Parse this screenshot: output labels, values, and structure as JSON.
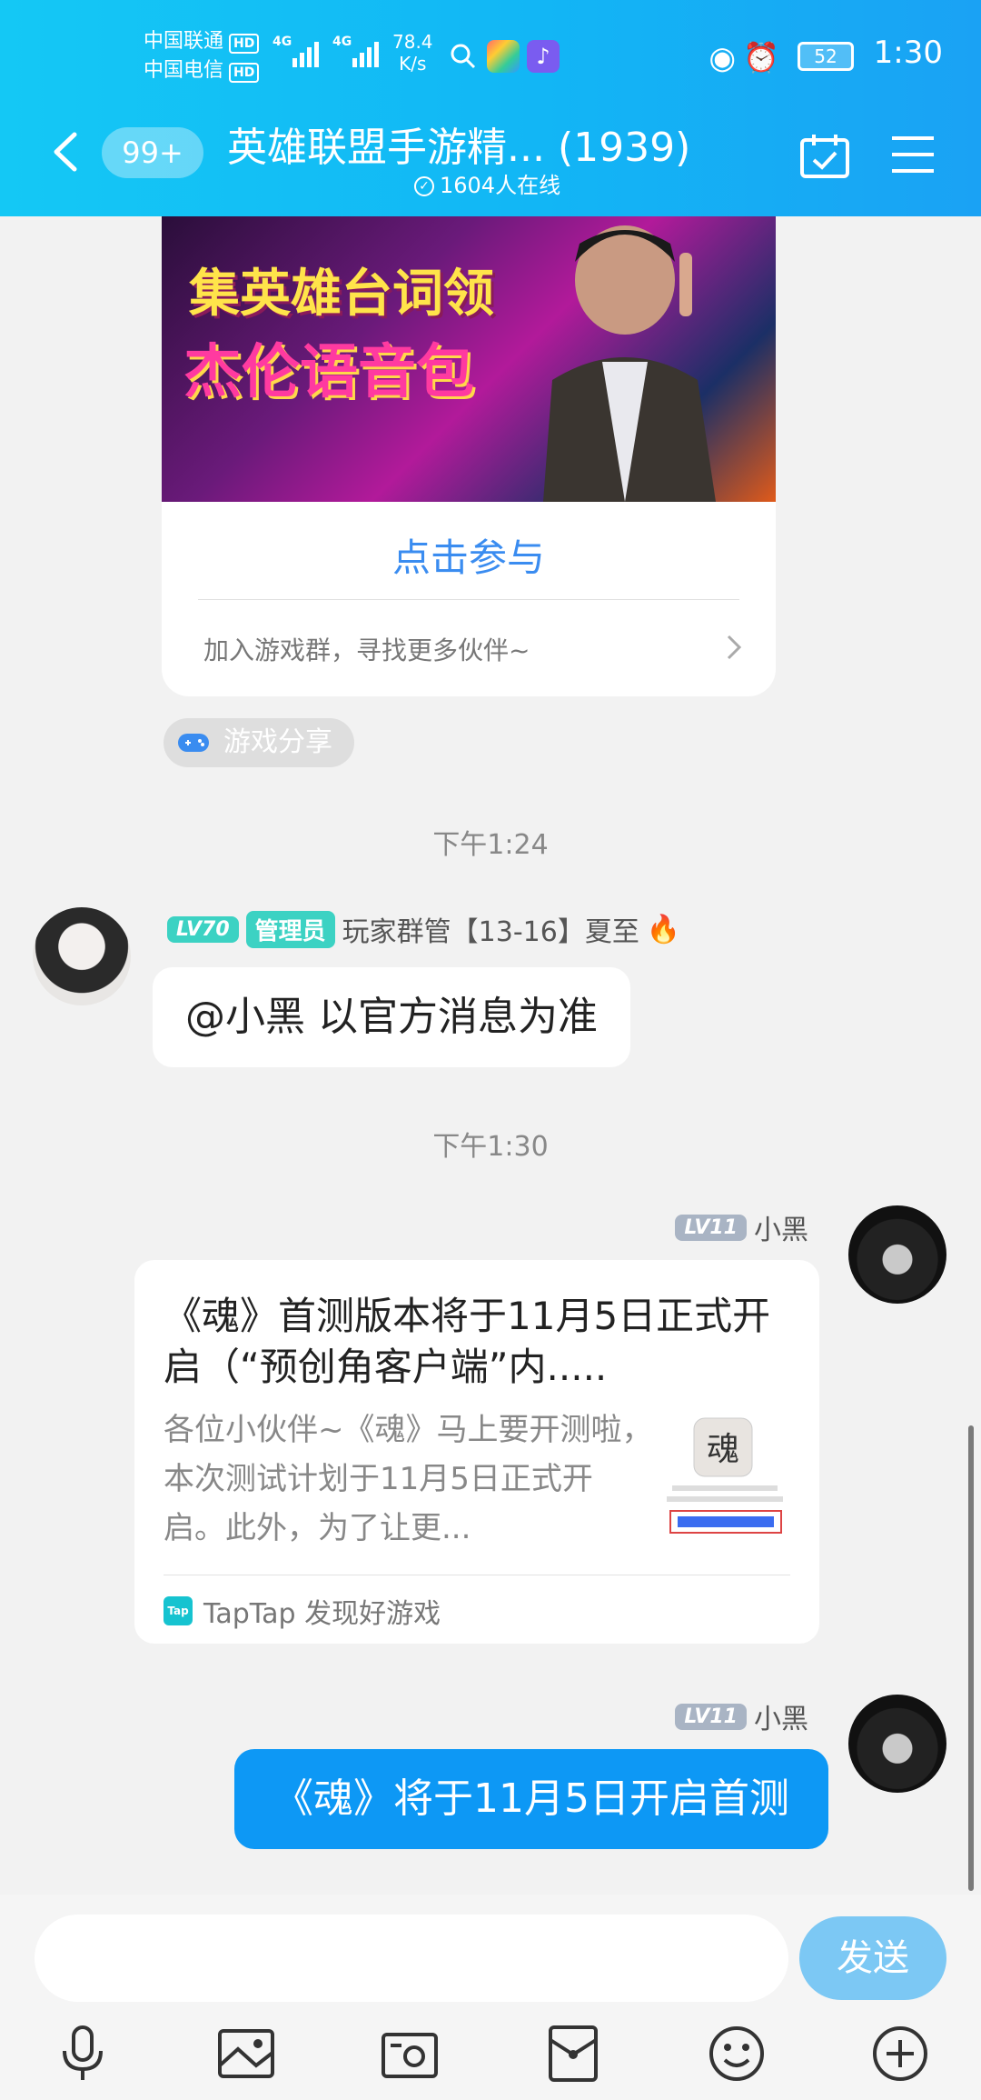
{
  "status_bar": {
    "carrier1": "中国联通",
    "carrier2": "中国电信",
    "hd": "HD",
    "net1": "4G",
    "net2": "4G",
    "speed_value": "78.4",
    "speed_unit": "K/s",
    "battery": "52",
    "time": "1:30"
  },
  "nav": {
    "unread_badge": "99+",
    "title": "英雄联盟手游精... (1939)",
    "online": "1604人在线"
  },
  "promo_card": {
    "banner_line1": "集英雄台词领",
    "banner_line2": "杰伦语音包",
    "action": "点击参与",
    "subtitle": "加入游戏群，寻找更多伙伴~"
  },
  "game_share_tag": "游戏分享",
  "timestamps": [
    "下午1:24",
    "下午1:30"
  ],
  "messages": [
    {
      "level": "LV70",
      "role": "管理员",
      "sender": "玩家群管【13-16】夏至",
      "text": "@小黑 以官方消息为准"
    },
    {
      "level": "LV11",
      "sender": "小黑",
      "share": {
        "title": "《魂》首测版本将于11月5日正式开启（“预创角客户端”内.....",
        "desc": "各位小伙伴~《魂》马上要开测啦，本次测试计划于11月5日正式开启。此外，为了让更...",
        "source": "TapTap 发现好游戏",
        "source_logo": "Tap"
      }
    },
    {
      "level": "LV11",
      "sender": "小黑",
      "text": "《魂》将于11月5日开启首测"
    }
  ],
  "input": {
    "placeholder": "",
    "send_label": "发送"
  },
  "colors": {
    "header": "#12b6f5",
    "accent_blue": "#0d98f5",
    "admin_green": "#3cd2c3",
    "level_gray": "#a9b4c4"
  }
}
